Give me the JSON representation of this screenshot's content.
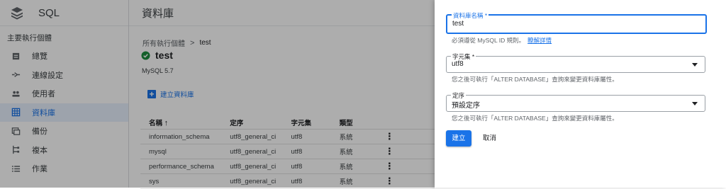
{
  "sidebar": {
    "app_name": "SQL",
    "section_title": "主要執行個體",
    "items": [
      {
        "label": "總覽",
        "icon": "overview-icon"
      },
      {
        "label": "連線設定",
        "icon": "connections-icon"
      },
      {
        "label": "使用者",
        "icon": "users-icon"
      },
      {
        "label": "資料庫",
        "icon": "databases-icon",
        "active": true
      },
      {
        "label": "備份",
        "icon": "backups-icon"
      },
      {
        "label": "複本",
        "icon": "replicas-icon"
      },
      {
        "label": "作業",
        "icon": "operations-icon"
      }
    ]
  },
  "main": {
    "header_title": "資料庫",
    "breadcrumb": {
      "parent": "所有執行個體",
      "separator": ">",
      "current": "test"
    },
    "instance_name": "test",
    "version": "MySQL 5.7",
    "create_label": "建立資料庫",
    "table": {
      "headers": {
        "name": "名稱",
        "collation": "定序",
        "charset": "字元集",
        "type": "類型"
      },
      "rows": [
        {
          "name": "information_schema",
          "collation": "utf8_general_ci",
          "charset": "utf8",
          "type": "系統"
        },
        {
          "name": "mysql",
          "collation": "utf8_general_ci",
          "charset": "utf8",
          "type": "系統"
        },
        {
          "name": "performance_schema",
          "collation": "utf8_general_ci",
          "charset": "utf8",
          "type": "系統"
        },
        {
          "name": "sys",
          "collation": "utf8_general_ci",
          "charset": "utf8",
          "type": "系統"
        }
      ]
    }
  },
  "panel": {
    "db_name": {
      "label": "資料庫名稱 *",
      "value": "test",
      "helper": "必須遵從 MySQL ID 規則。",
      "link": "瞭解詳情"
    },
    "charset": {
      "label": "字元集 *",
      "value": "utf8",
      "helper": "您之後可執行「ALTER DATABASE」查詢來變更資料庫屬性。"
    },
    "collation": {
      "label": "定序",
      "value": "預設定序",
      "helper": "您之後可執行「ALTER DATABASE」查詢來變更資料庫屬性。"
    },
    "create_button": "建立",
    "cancel_button": "取消"
  },
  "colors": {
    "accent": "#1a73e8",
    "success": "#1e8e3e"
  }
}
